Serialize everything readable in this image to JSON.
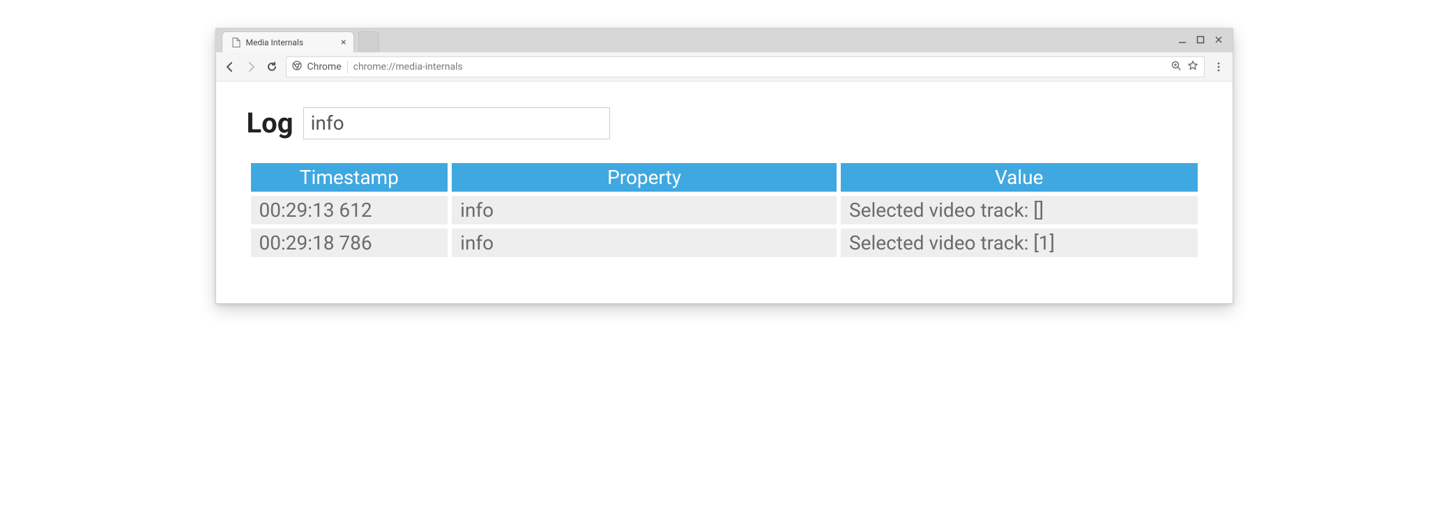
{
  "tab": {
    "title": "Media Internals"
  },
  "omnibox": {
    "scheme_label": "Chrome",
    "url": "chrome://media-internals"
  },
  "log": {
    "heading": "Log",
    "filter_value": "info",
    "columns": {
      "timestamp": "Timestamp",
      "property": "Property",
      "value": "Value"
    },
    "rows": [
      {
        "timestamp": "00:29:13 612",
        "property": "info",
        "value": "Selected video track: []"
      },
      {
        "timestamp": "00:29:18 786",
        "property": "info",
        "value": "Selected video track: [1]"
      }
    ]
  }
}
